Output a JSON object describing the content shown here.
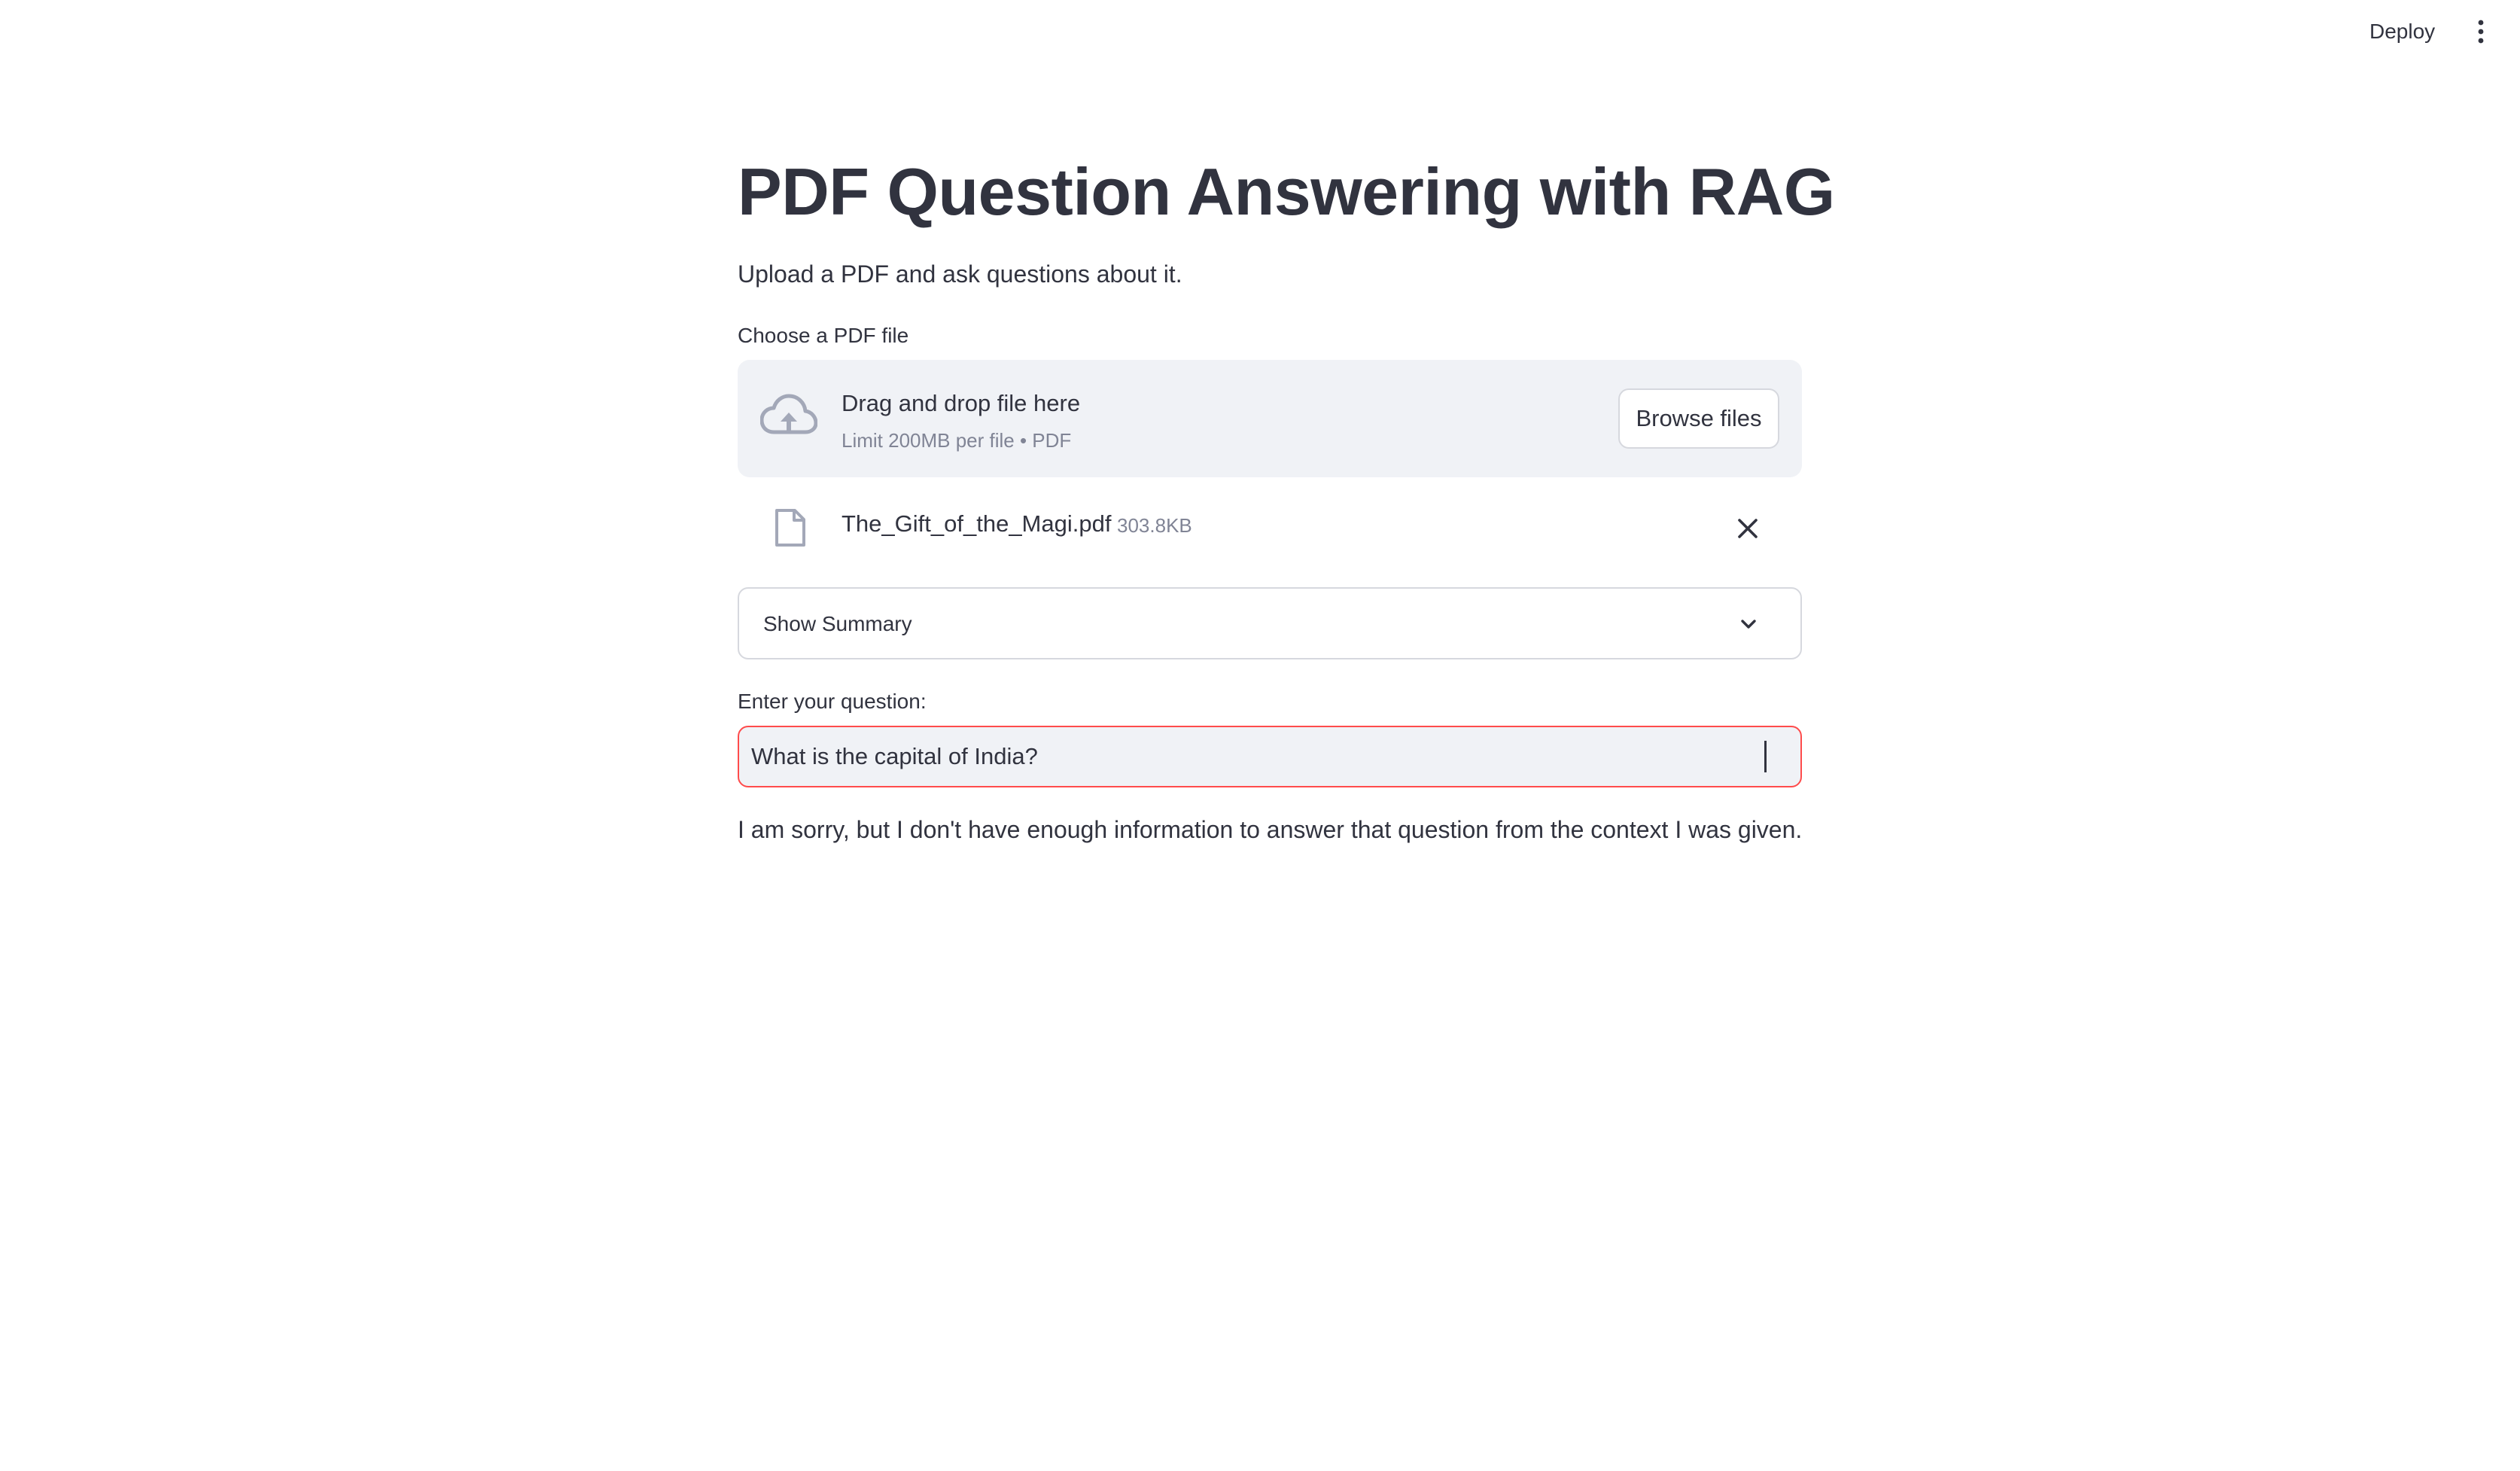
{
  "header": {
    "deploy_label": "Deploy",
    "menu_icon": "vertical-ellipsis-icon"
  },
  "page": {
    "title": "PDF Question Answering with RAG",
    "subtitle": "Upload a PDF and ask questions about it."
  },
  "uploader": {
    "label": "Choose a PDF file",
    "instructions": "Drag and drop file here",
    "limit": "Limit 200MB per file • PDF",
    "browse_label": "Browse files",
    "icon": "cloud-upload-icon"
  },
  "uploaded_file": {
    "name": "The_Gift_of_the_Magi.pdf",
    "size": "303.8KB",
    "icon": "file-icon",
    "remove_icon": "close-icon"
  },
  "summary_expander": {
    "label": "Show Summary",
    "icon": "chevron-down-icon"
  },
  "question": {
    "label": "Enter your question:",
    "value": "What is the capital of India?"
  },
  "answer": {
    "text": "I am sorry, but I don't have enough information to answer that question from the context I was given."
  },
  "colors": {
    "text": "#31333f",
    "muted": "#808495",
    "panel": "#f0f2f6",
    "border": "#d6d8de",
    "focus": "#ff4b4b"
  }
}
